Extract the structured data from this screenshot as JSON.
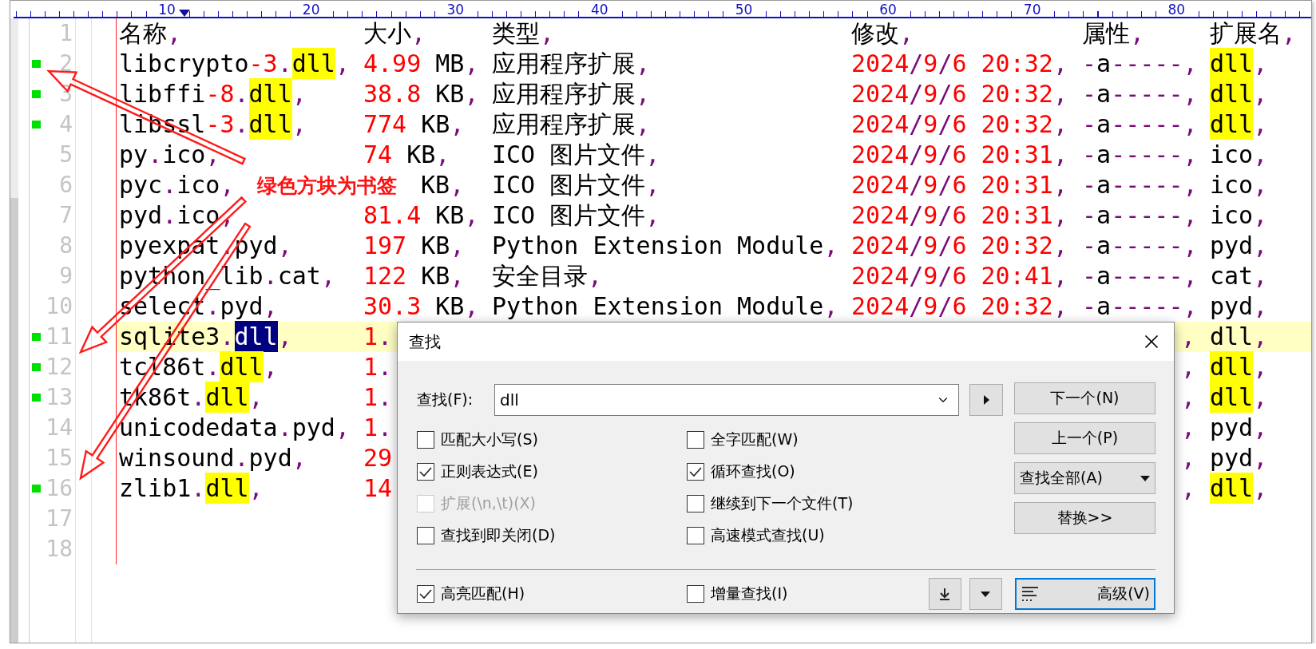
{
  "ruler": {
    "labels": [
      "10",
      "20",
      "30",
      "40",
      "50",
      "60",
      "70",
      "80"
    ]
  },
  "rows": [
    {
      "line": "1",
      "bookmark": false,
      "name": "名称,",
      "size": "大小,",
      "type": "类型,",
      "modified": "修改,",
      "attr": "属性,",
      "ext": "扩展名,"
    },
    {
      "line": "2",
      "bookmark": true,
      "match": true,
      "name": "libcrypto-3.dll,",
      "size": "4.99 MB,",
      "type": "应用程序扩展,",
      "modified": "2024/9/6 20:32,",
      "attr": "-a-----,",
      "ext": "dll,"
    },
    {
      "line": "3",
      "bookmark": true,
      "match": true,
      "name": "libffi-8.dll,",
      "size": "38.8 KB,",
      "type": "应用程序扩展,",
      "modified": "2024/9/6 20:32,",
      "attr": "-a-----,",
      "ext": "dll,"
    },
    {
      "line": "4",
      "bookmark": true,
      "match": true,
      "name": "libssl-3.dll,",
      "size": "774 KB,",
      "type": "应用程序扩展,",
      "modified": "2024/9/6 20:32,",
      "attr": "-a-----,",
      "ext": "dll,"
    },
    {
      "line": "5",
      "bookmark": false,
      "name": "py.ico,",
      "size": "74 KB,",
      "type": "ICO 图片文件,",
      "modified": "2024/9/6 20:31,",
      "attr": "-a-----,",
      "ext": "ico,"
    },
    {
      "line": "6",
      "bookmark": false,
      "name": "pyc.ico,",
      "size": "KB,",
      "size_covered": true,
      "type": "ICO 图片文件,",
      "modified": "2024/9/6 20:31,",
      "attr": "-a-----,",
      "ext": "ico,"
    },
    {
      "line": "7",
      "bookmark": false,
      "name": "pyd.ico,",
      "size": "81.4 KB,",
      "type": "ICO 图片文件,",
      "modified": "2024/9/6 20:31,",
      "attr": "-a-----,",
      "ext": "ico,"
    },
    {
      "line": "8",
      "bookmark": false,
      "name": "pyexpat.pyd,",
      "size": "197 KB,",
      "type": "Python Extension Module,",
      "modified": "2024/9/6 20:32,",
      "attr": "-a-----,",
      "ext": "pyd,"
    },
    {
      "line": "9",
      "bookmark": false,
      "name": "python_lib.cat,",
      "size": "122 KB,",
      "type": "安全目录,",
      "modified": "2024/9/6 20:41,",
      "attr": "-a-----,",
      "ext": "cat,"
    },
    {
      "line": "10",
      "bookmark": false,
      "name": "select.pyd,",
      "size": "30.3 KB,",
      "type": "Python Extension Module,",
      "modified": "2024/9/6 20:32,",
      "attr": "-a-----,",
      "ext": "pyd,"
    },
    {
      "line": "11",
      "bookmark": true,
      "match": true,
      "current": true,
      "selected_match": true,
      "covered": true,
      "name": "sqlite3.dll,",
      "size": "1.",
      "attr": ",",
      "ext": "dll,"
    },
    {
      "line": "12",
      "bookmark": true,
      "match": true,
      "covered": true,
      "name": "tcl86t.dll,",
      "size": "1.",
      "attr": ",",
      "ext": "dll,"
    },
    {
      "line": "13",
      "bookmark": true,
      "match": true,
      "covered": true,
      "name": "tk86t.dll,",
      "size": "1.",
      "attr": ",",
      "ext": "dll,"
    },
    {
      "line": "14",
      "bookmark": false,
      "covered": true,
      "name": "unicodedata.pyd,",
      "size": "1.",
      "attr": ",",
      "ext": "pyd,"
    },
    {
      "line": "15",
      "bookmark": false,
      "covered": true,
      "name": "winsound.pyd,",
      "size": "29",
      "attr": ",",
      "ext": "pyd,"
    },
    {
      "line": "16",
      "bookmark": true,
      "match": true,
      "covered": true,
      "name": "zlib1.dll,",
      "size": "14",
      "attr": ",",
      "ext": "dll,"
    },
    {
      "line": "17",
      "bookmark": false
    },
    {
      "line": "18",
      "bookmark": false
    }
  ],
  "annotation": {
    "text": "绿色方块为书签"
  },
  "find_dialog": {
    "title": "查找",
    "find_label": "查找(F):",
    "find_value": "dll",
    "buttons": [
      {
        "label": "下一个(N)",
        "kind": "plain"
      },
      {
        "label": "上一个(P)",
        "kind": "plain"
      },
      {
        "label": "查找全部(A)",
        "kind": "dropdown"
      },
      {
        "label": "替换>>",
        "kind": "plain"
      }
    ],
    "options": [
      {
        "label": "匹配大小写(S)",
        "checked": false,
        "disabled": false
      },
      {
        "label": "全字匹配(W)",
        "checked": false,
        "disabled": false
      },
      {
        "label": "正则表达式(E)",
        "checked": true,
        "disabled": false
      },
      {
        "label": "循环查找(O)",
        "checked": true,
        "disabled": false
      },
      {
        "label": "扩展(\\n,\\t)(X)",
        "checked": false,
        "disabled": true
      },
      {
        "label": "继续到下一个文件(T)",
        "checked": false,
        "disabled": false
      },
      {
        "label": "查找到即关闭(D)",
        "checked": false,
        "disabled": false
      },
      {
        "label": "高速模式查找(U)",
        "checked": false,
        "disabled": false
      }
    ],
    "bottom_options": [
      {
        "label": "高亮匹配(H)",
        "checked": true,
        "disabled": false
      },
      {
        "label": "增量查找(I)",
        "checked": false,
        "disabled": false
      }
    ],
    "advanced_button": {
      "label": "高级(V)",
      "focused": true
    }
  }
}
